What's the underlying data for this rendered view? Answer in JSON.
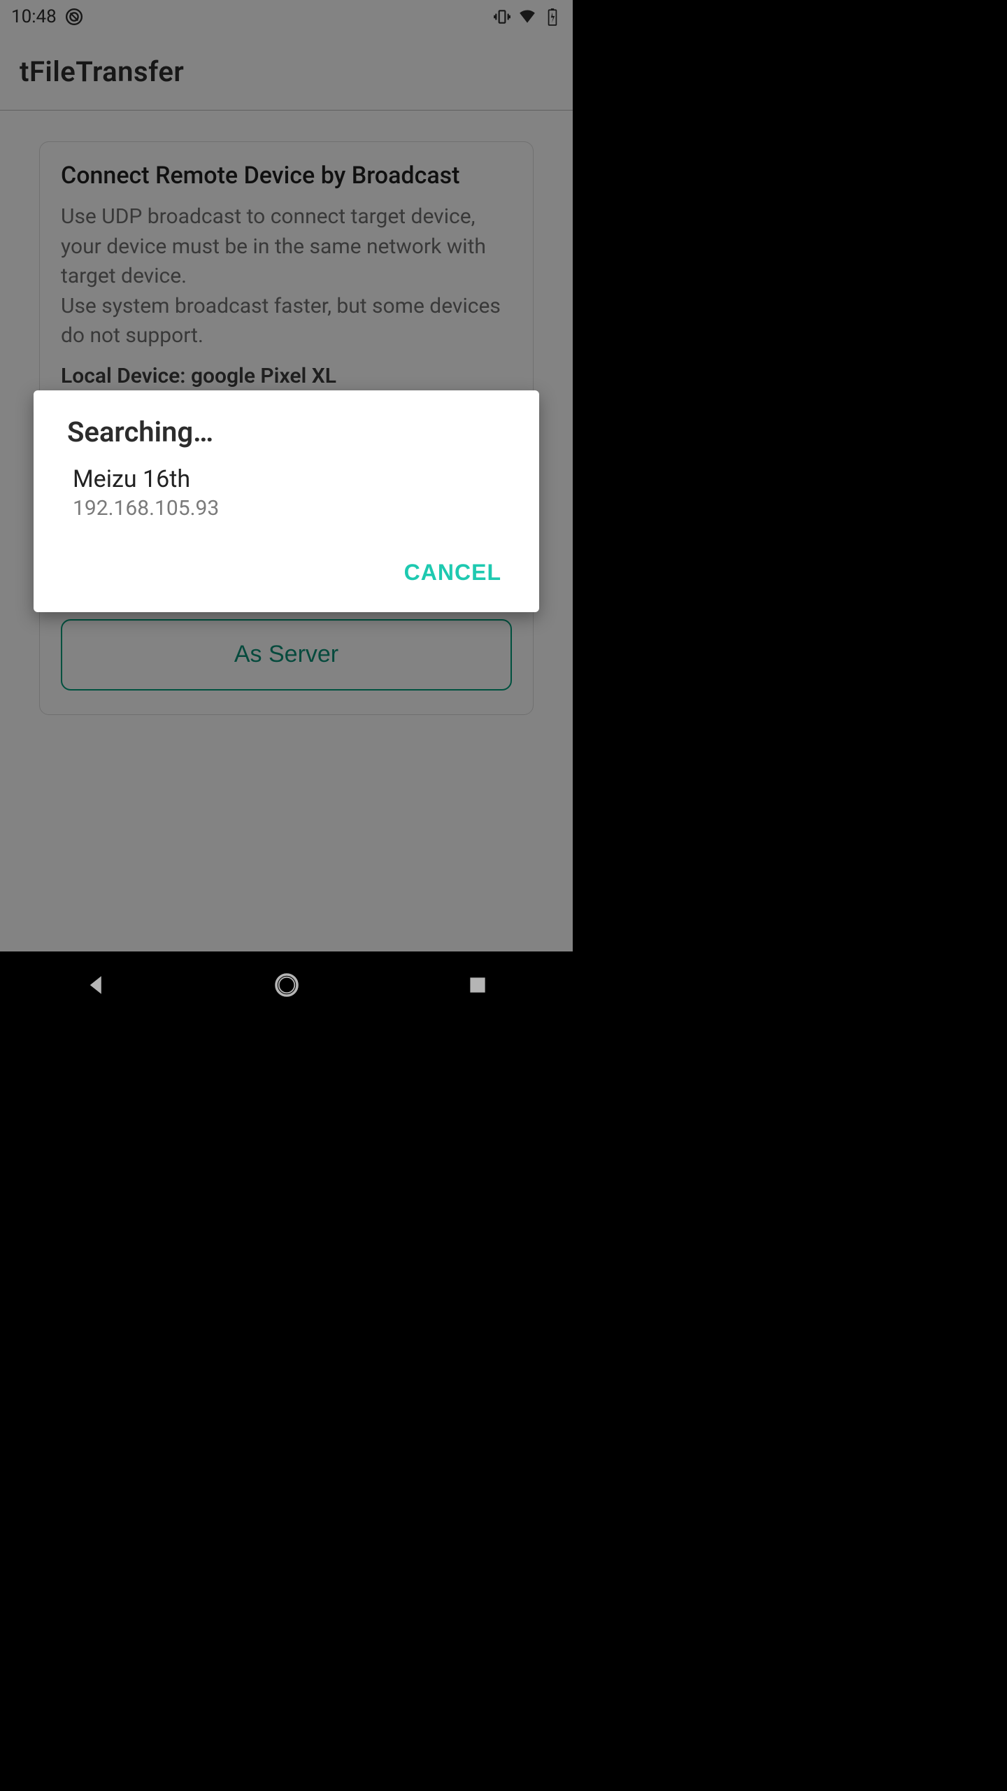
{
  "status": {
    "time": "10:48",
    "do_not_disturb_icon": "dnd-icon",
    "vibrate_icon": "vibrate-icon",
    "wifi_icon": "wifi-icon",
    "battery_icon": "battery-charging-icon"
  },
  "app": {
    "title": "tFileTransfer"
  },
  "card": {
    "heading": "Connect Remote Device by Broadcast",
    "desc1": "Use UDP broadcast to connect target device, your device must be in the same network with target device.",
    "desc2": "Use system broadcast faster, but some devices do not support.",
    "local_label_prefix": "Local Device: ",
    "local_device": "google Pixel XL",
    "as_server_label": "As Server"
  },
  "dialog": {
    "title": "Searching…",
    "devices": [
      {
        "name": "Meizu 16th",
        "ip": "192.168.105.93"
      }
    ],
    "cancel_label": "CANCEL"
  },
  "nav": {
    "back": "back",
    "home": "home",
    "recents": "recents"
  }
}
